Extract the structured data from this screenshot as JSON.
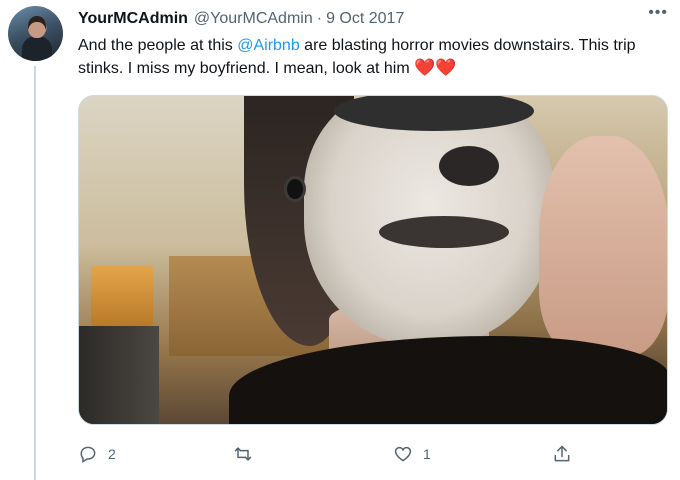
{
  "tweet": {
    "display_name": "YourMCAdmin",
    "handle": "@YourMCAdmin",
    "separator": "·",
    "date": "9 Oct 2017",
    "more_label": "•••",
    "text_before_mention": "And the people at this ",
    "mention": "@Airbnb",
    "text_after_mention": " are blasting horror movies downstairs. This trip stinks. I miss my boyfriend. I mean, look at him ",
    "emoji": "❤️❤️"
  },
  "media": {
    "alt": "Selfie photo of a person wearing white horror-style face paint"
  },
  "actions": {
    "reply_count": "2",
    "retweet_count": "",
    "like_count": "1",
    "share_count": ""
  },
  "colors": {
    "accent": "#1d9bf0",
    "muted": "#536471",
    "heart": "#e0245e"
  }
}
